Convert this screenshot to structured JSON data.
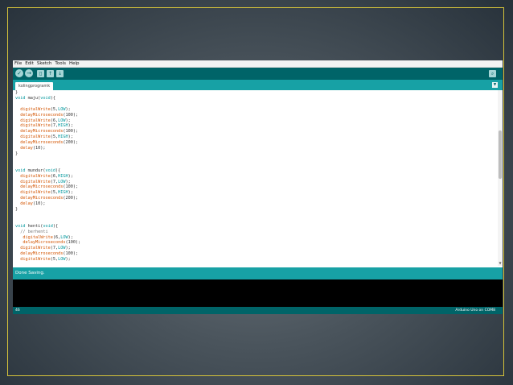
{
  "menu": [
    "File",
    "Edit",
    "Sketch",
    "Tools",
    "Help"
  ],
  "toolbar": {
    "verify_icon": "✓",
    "upload_icon": "→",
    "new_icon": "▯",
    "open_icon": "↑",
    "save_icon": "↓",
    "serial_icon": "⌕"
  },
  "tab": {
    "label": "kolingprogramk",
    "menu_icon": "▼"
  },
  "code_lines": [
    "}",
    "void maju(void){",
    "",
    "  digitalWrite(5,LOW);",
    "  delayMicroseconds(100);",
    "  digitalWrite(6,LOW);",
    "  digitalWrite(7,HIGH);",
    "  delayMicroseconds(100);",
    "  digitalWrite(5,HIGH);",
    "  delayMicroseconds(200);",
    "  delay(10);",
    "}",
    "",
    "",
    "void mundur(void){",
    "  digitalWrite(6,HIGH);",
    "  digitalWrite(7,LOW);",
    "  delayMicroseconds(100);",
    "  digitalWrite(5,HIGH);",
    "  delayMicroseconds(200);",
    "  delay(10);",
    "}",
    "",
    "",
    "void henti(void){",
    "  // berhenti",
    "   digitalWrite(6,LOW);",
    "   delayMicroseconds(100);",
    "  digitalWrite(7,LOW);",
    "  delayMicroseconds(100);",
    "  digitalWrite(5,LOW);"
  ],
  "status": "Done Saving.",
  "footer": {
    "line": "46",
    "board": "Arduino Uno on COM8"
  },
  "colors": {
    "toolbar": "#006468",
    "tabstrip": "#17a1a5",
    "keyword": "#00979c",
    "function": "#d35400",
    "frame_border": "#d4c23a"
  }
}
